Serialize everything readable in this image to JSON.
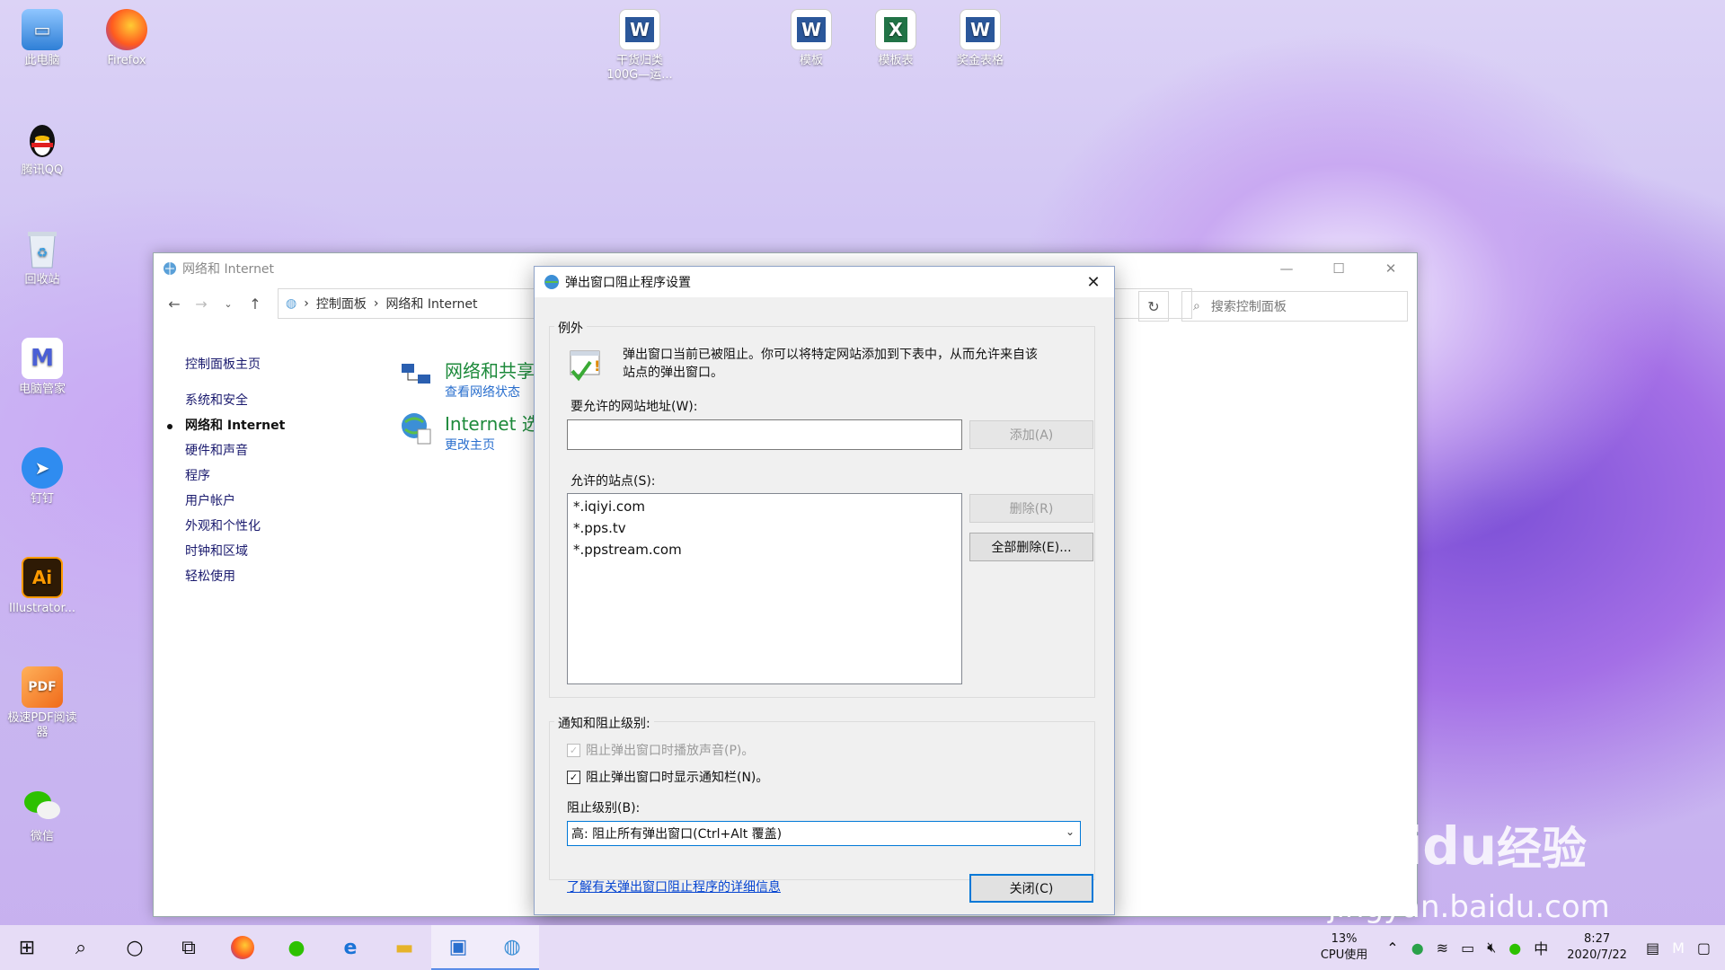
{
  "desktop": {
    "left_icons": [
      {
        "label": "此电脑",
        "icon": "computer-icon",
        "color": "#3a8ee6"
      },
      {
        "label": "腾讯QQ",
        "icon": "qq-penguin-icon",
        "color": "#111111"
      },
      {
        "label": "回收站",
        "icon": "recycle-bin-icon",
        "color": "#cfd8e3"
      },
      {
        "label": "电脑管家",
        "icon": "pc-manager-icon",
        "color": "#5a6fd6"
      },
      {
        "label": "钉钉",
        "icon": "dingtalk-icon",
        "color": "#2f8cf0"
      },
      {
        "label": "Illustrator...",
        "icon": "illustrator-icon",
        "color": "#2e1a05"
      },
      {
        "label": "极速PDF阅读器",
        "icon": "pdf-reader-icon",
        "color": "#f07a2a"
      },
      {
        "label": "微信",
        "icon": "wechat-icon",
        "color": "#2dc100"
      }
    ],
    "firefox": {
      "label": "Firefox",
      "icon": "firefox-icon"
    },
    "top_files": [
      {
        "label": "干货归类100G—运...",
        "icon": "word-doc-icon",
        "color": "#2b579a",
        "letter": "W"
      },
      {
        "label": "模板",
        "icon": "word-doc-icon",
        "color": "#2b579a",
        "letter": "W"
      },
      {
        "label": "模板表",
        "icon": "excel-sheet-icon",
        "color": "#217346",
        "letter": "X"
      },
      {
        "label": "奖金表格",
        "icon": "word-doc-icon",
        "color": "#2b579a",
        "letter": "W"
      }
    ]
  },
  "control_panel": {
    "title": "网络和 Internet",
    "breadcrumb": [
      "控制面板",
      "网络和 Internet"
    ],
    "search_placeholder": "搜索控制面板",
    "sidebar": [
      "控制面板主页",
      "系统和安全",
      "网络和 Internet",
      "硬件和声音",
      "程序",
      "用户帐户",
      "外观和个性化",
      "时钟和区域",
      "轻松使用"
    ],
    "categories": [
      {
        "title": "网络和共享",
        "sub": "查看网络状态",
        "icon": "network-sharing-icon"
      },
      {
        "title": "Internet 选",
        "sub": "更改主页",
        "icon": "internet-options-icon"
      }
    ]
  },
  "dialog": {
    "title": "弹出窗口阻止程序设置",
    "exceptions_group": "例外",
    "info_text_line1": "弹出窗口当前已被阻止。你可以将特定网站添加到下表中，从而允许来自该",
    "info_text_line2": "站点的弹出窗口。",
    "address_label": "要允许的网站地址(W):",
    "address_value": "",
    "add_button": "添加(A)",
    "allowed_sites_label": "允许的站点(S):",
    "allowed_sites": [
      "*.iqiyi.com",
      "*.pps.tv",
      "*.ppstream.com"
    ],
    "remove_button": "删除(R)",
    "remove_all_button": "全部删除(E)...",
    "notify_group": "通知和阻止级别:",
    "play_sound_checkbox": "阻止弹出窗口时播放声音(P)。",
    "show_bar_checkbox": "阻止弹出窗口时显示通知栏(N)。",
    "blocking_level_label": "阻止级别(B):",
    "blocking_level_value": "高: 阻止所有弹出窗口(Ctrl+Alt 覆盖)",
    "learn_more_link": "了解有关弹出窗口阻止程序的详细信息",
    "close_button": "关闭(C)"
  },
  "taskbar": {
    "cpu_percent": "13%",
    "cpu_label": "CPU使用",
    "time": "8:27",
    "date": "2020/7/22",
    "ime": "中"
  },
  "watermark": {
    "text1": "Bai",
    "text2": "du",
    "text3": "经验",
    "url": "jingyan.baidu.com"
  }
}
